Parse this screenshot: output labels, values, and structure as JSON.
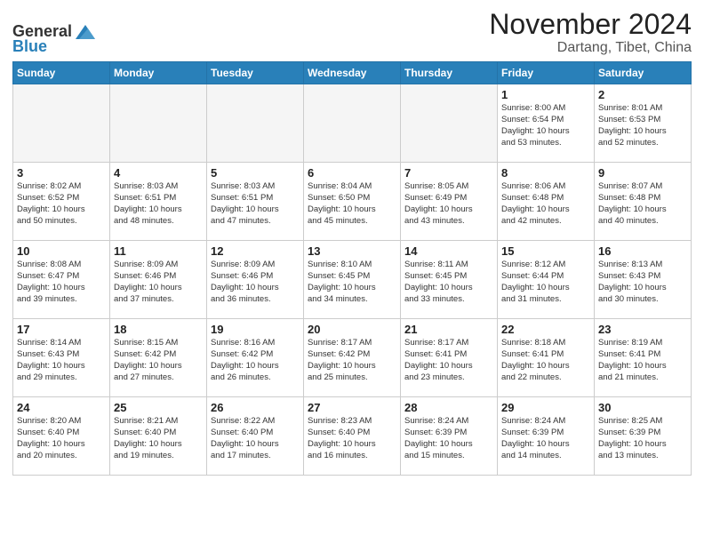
{
  "header": {
    "logo_general": "General",
    "logo_blue": "Blue",
    "month": "November 2024",
    "location": "Dartang, Tibet, China"
  },
  "weekdays": [
    "Sunday",
    "Monday",
    "Tuesday",
    "Wednesday",
    "Thursday",
    "Friday",
    "Saturday"
  ],
  "weeks": [
    [
      {
        "day": "",
        "info": ""
      },
      {
        "day": "",
        "info": ""
      },
      {
        "day": "",
        "info": ""
      },
      {
        "day": "",
        "info": ""
      },
      {
        "day": "",
        "info": ""
      },
      {
        "day": "1",
        "info": "Sunrise: 8:00 AM\nSunset: 6:54 PM\nDaylight: 10 hours\nand 53 minutes."
      },
      {
        "day": "2",
        "info": "Sunrise: 8:01 AM\nSunset: 6:53 PM\nDaylight: 10 hours\nand 52 minutes."
      }
    ],
    [
      {
        "day": "3",
        "info": "Sunrise: 8:02 AM\nSunset: 6:52 PM\nDaylight: 10 hours\nand 50 minutes."
      },
      {
        "day": "4",
        "info": "Sunrise: 8:03 AM\nSunset: 6:51 PM\nDaylight: 10 hours\nand 48 minutes."
      },
      {
        "day": "5",
        "info": "Sunrise: 8:03 AM\nSunset: 6:51 PM\nDaylight: 10 hours\nand 47 minutes."
      },
      {
        "day": "6",
        "info": "Sunrise: 8:04 AM\nSunset: 6:50 PM\nDaylight: 10 hours\nand 45 minutes."
      },
      {
        "day": "7",
        "info": "Sunrise: 8:05 AM\nSunset: 6:49 PM\nDaylight: 10 hours\nand 43 minutes."
      },
      {
        "day": "8",
        "info": "Sunrise: 8:06 AM\nSunset: 6:48 PM\nDaylight: 10 hours\nand 42 minutes."
      },
      {
        "day": "9",
        "info": "Sunrise: 8:07 AM\nSunset: 6:48 PM\nDaylight: 10 hours\nand 40 minutes."
      }
    ],
    [
      {
        "day": "10",
        "info": "Sunrise: 8:08 AM\nSunset: 6:47 PM\nDaylight: 10 hours\nand 39 minutes."
      },
      {
        "day": "11",
        "info": "Sunrise: 8:09 AM\nSunset: 6:46 PM\nDaylight: 10 hours\nand 37 minutes."
      },
      {
        "day": "12",
        "info": "Sunrise: 8:09 AM\nSunset: 6:46 PM\nDaylight: 10 hours\nand 36 minutes."
      },
      {
        "day": "13",
        "info": "Sunrise: 8:10 AM\nSunset: 6:45 PM\nDaylight: 10 hours\nand 34 minutes."
      },
      {
        "day": "14",
        "info": "Sunrise: 8:11 AM\nSunset: 6:45 PM\nDaylight: 10 hours\nand 33 minutes."
      },
      {
        "day": "15",
        "info": "Sunrise: 8:12 AM\nSunset: 6:44 PM\nDaylight: 10 hours\nand 31 minutes."
      },
      {
        "day": "16",
        "info": "Sunrise: 8:13 AM\nSunset: 6:43 PM\nDaylight: 10 hours\nand 30 minutes."
      }
    ],
    [
      {
        "day": "17",
        "info": "Sunrise: 8:14 AM\nSunset: 6:43 PM\nDaylight: 10 hours\nand 29 minutes."
      },
      {
        "day": "18",
        "info": "Sunrise: 8:15 AM\nSunset: 6:42 PM\nDaylight: 10 hours\nand 27 minutes."
      },
      {
        "day": "19",
        "info": "Sunrise: 8:16 AM\nSunset: 6:42 PM\nDaylight: 10 hours\nand 26 minutes."
      },
      {
        "day": "20",
        "info": "Sunrise: 8:17 AM\nSunset: 6:42 PM\nDaylight: 10 hours\nand 25 minutes."
      },
      {
        "day": "21",
        "info": "Sunrise: 8:17 AM\nSunset: 6:41 PM\nDaylight: 10 hours\nand 23 minutes."
      },
      {
        "day": "22",
        "info": "Sunrise: 8:18 AM\nSunset: 6:41 PM\nDaylight: 10 hours\nand 22 minutes."
      },
      {
        "day": "23",
        "info": "Sunrise: 8:19 AM\nSunset: 6:41 PM\nDaylight: 10 hours\nand 21 minutes."
      }
    ],
    [
      {
        "day": "24",
        "info": "Sunrise: 8:20 AM\nSunset: 6:40 PM\nDaylight: 10 hours\nand 20 minutes."
      },
      {
        "day": "25",
        "info": "Sunrise: 8:21 AM\nSunset: 6:40 PM\nDaylight: 10 hours\nand 19 minutes."
      },
      {
        "day": "26",
        "info": "Sunrise: 8:22 AM\nSunset: 6:40 PM\nDaylight: 10 hours\nand 17 minutes."
      },
      {
        "day": "27",
        "info": "Sunrise: 8:23 AM\nSunset: 6:40 PM\nDaylight: 10 hours\nand 16 minutes."
      },
      {
        "day": "28",
        "info": "Sunrise: 8:24 AM\nSunset: 6:39 PM\nDaylight: 10 hours\nand 15 minutes."
      },
      {
        "day": "29",
        "info": "Sunrise: 8:24 AM\nSunset: 6:39 PM\nDaylight: 10 hours\nand 14 minutes."
      },
      {
        "day": "30",
        "info": "Sunrise: 8:25 AM\nSunset: 6:39 PM\nDaylight: 10 hours\nand 13 minutes."
      }
    ]
  ]
}
